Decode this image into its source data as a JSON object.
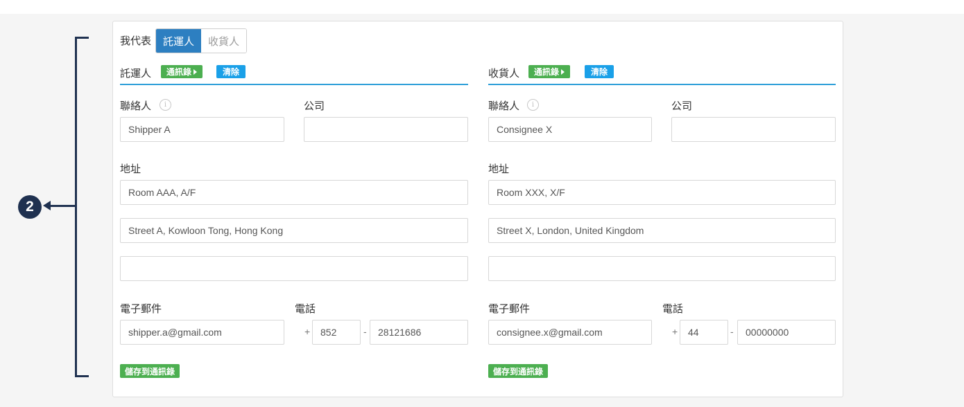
{
  "marker": {
    "number": "2"
  },
  "role_selector": {
    "label": "我代表",
    "options": [
      "託運人",
      "收貨人"
    ],
    "selected": "託運人"
  },
  "shipper": {
    "title": "託運人",
    "address_book_label": "通訊錄",
    "clear_label": "清除",
    "contact_label": "聯絡人",
    "contact_value": "Shipper A",
    "company_label": "公司",
    "company_value": "",
    "address_label": "地址",
    "address_line1": "Room AAA, A/F",
    "address_line2": "Street A, Kowloon Tong, Hong Kong",
    "address_line3": "",
    "email_label": "電子郵件",
    "email_value": "shipper.a@gmail.com",
    "phone_label": "電話",
    "phone_plus": "+",
    "phone_code": "852",
    "phone_dash": "-",
    "phone_number": "28121686",
    "save_label": "儲存到通訊錄"
  },
  "consignee": {
    "title": "收貨人",
    "address_book_label": "通訊錄",
    "clear_label": "清除",
    "contact_label": "聯絡人",
    "contact_value": "Consignee X",
    "company_label": "公司",
    "company_value": "",
    "address_label": "地址",
    "address_line1": "Room XXX, X/F",
    "address_line2": "Street X, London, United Kingdom",
    "address_line3": "",
    "email_label": "電子郵件",
    "email_value": "consignee.x@gmail.com",
    "phone_label": "電話",
    "phone_plus": "+",
    "phone_code": "44",
    "phone_dash": "-",
    "phone_number": "00000000",
    "save_label": "儲存到通訊錄"
  },
  "icons": {
    "info": "info-circle-icon",
    "address_book_arrow": "caret-right-icon"
  },
  "colors": {
    "accent_blue": "#2d7fc1",
    "green": "#4caf50",
    "clear_blue": "#1aa0e8",
    "annotation": "#1f3150"
  }
}
